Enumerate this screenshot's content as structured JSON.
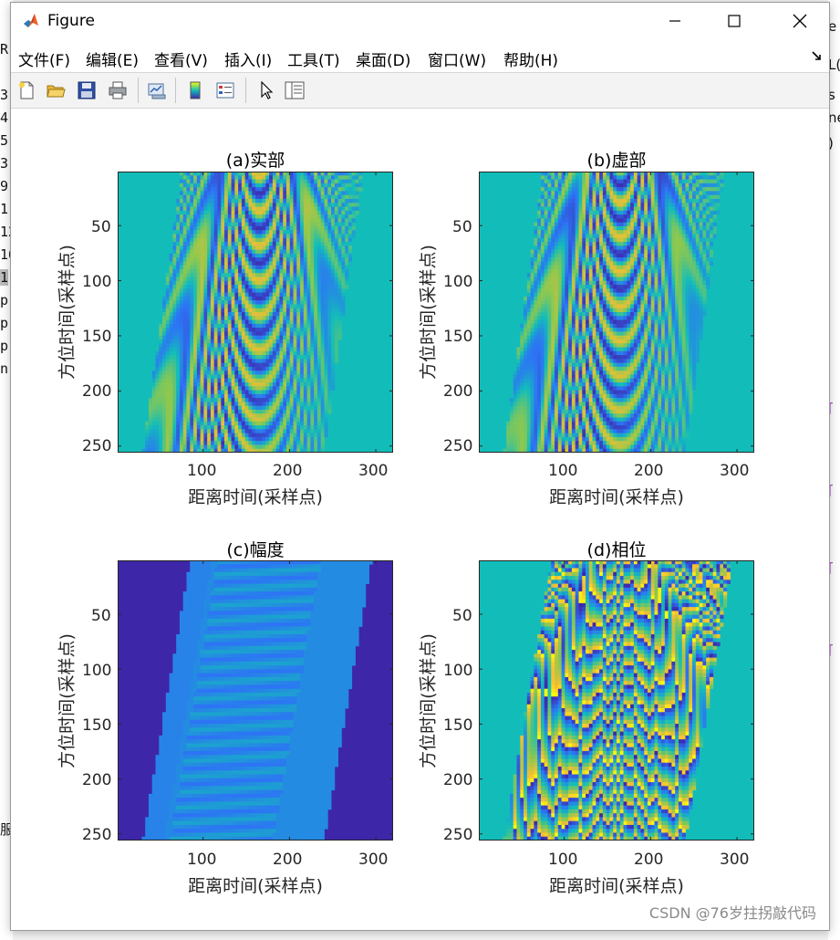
{
  "window": {
    "title": "Figure",
    "controls": {
      "minimize": "minimize",
      "maximize": "maximize",
      "close": "close"
    }
  },
  "menu": [
    "文件(F)",
    "编辑(E)",
    "查看(V)",
    "插入(I)",
    "工具(T)",
    "桌面(D)",
    "窗口(W)",
    "帮助(H)"
  ],
  "toolbar": [
    "new-figure-icon",
    "open-file-icon",
    "save-icon",
    "print-icon",
    "link-plot-icon",
    "colorbar-icon",
    "legend-icon",
    "pointer-icon",
    "property-inspector-icon"
  ],
  "background_text": {
    "left": [
      "R",
      "3.",
      "4.",
      "5.",
      "3.",
      "9.",
      "1(",
      "12",
      "16",
      "1",
      "p",
      "p",
      "p",
      "n",
      "服"
    ],
    "right": [
      "e",
      "L(",
      "s",
      "ne",
      ")"
    ]
  },
  "colors": {
    "parula_teal": "#12bdb9",
    "parula_dark": "#3e26a8",
    "parula_blue": "#2d74f5",
    "parula_yellow": "#f9fb0e"
  },
  "axes": [
    {
      "id": "a",
      "title": "(a)实部",
      "xlabel": "距离时间(采样点)",
      "ylabel": "方位时间(采样点)",
      "xticks": [
        "100",
        "200",
        "300"
      ],
      "yticks": [
        "50",
        "100",
        "150",
        "200",
        "250"
      ]
    },
    {
      "id": "b",
      "title": "(b)虚部",
      "xlabel": "距离时间(采样点)",
      "ylabel": "方位时间(采样点)",
      "xticks": [
        "100",
        "200",
        "300"
      ],
      "yticks": [
        "50",
        "100",
        "150",
        "200",
        "250"
      ]
    },
    {
      "id": "c",
      "title": "(c)幅度",
      "xlabel": "距离时间(采样点)",
      "ylabel": "方位时间(采样点)",
      "xticks": [
        "100",
        "200",
        "300"
      ],
      "yticks": [
        "50",
        "100",
        "150",
        "200",
        "250"
      ]
    },
    {
      "id": "d",
      "title": "(d)相位",
      "xlabel": "距离时间(采样点)",
      "ylabel": "方位时间(采样点)",
      "xticks": [
        "100",
        "200",
        "300"
      ],
      "yticks": [
        "50",
        "100",
        "150",
        "200",
        "250"
      ]
    }
  ],
  "chart_data": [
    {
      "type": "heatmap",
      "title": "(a)实部",
      "xlabel": "距离时间(采样点)",
      "ylabel": "方位时间(采样点)",
      "xlim": [
        1,
        320
      ],
      "ylim": [
        1,
        256
      ],
      "xticks": [
        100,
        200,
        300
      ],
      "yticks": [
        50,
        100,
        150,
        200,
        250
      ],
      "y_reversed": true,
      "colormap": "parula",
      "support_band": {
        "x_at_top": [
          75,
          285
        ],
        "x_at_bottom": [
          30,
          240
        ]
      }
    },
    {
      "type": "heatmap",
      "title": "(b)虚部",
      "xlabel": "距离时间(采样点)",
      "ylabel": "方位时间(采样点)",
      "xlim": [
        1,
        320
      ],
      "ylim": [
        1,
        256
      ],
      "xticks": [
        100,
        200,
        300
      ],
      "yticks": [
        50,
        100,
        150,
        200,
        250
      ],
      "y_reversed": true,
      "colormap": "parula",
      "support_band": {
        "x_at_top": [
          75,
          285
        ],
        "x_at_bottom": [
          30,
          240
        ]
      }
    },
    {
      "type": "heatmap",
      "title": "(c)幅度",
      "xlabel": "距离时间(采样点)",
      "ylabel": "方位时间(采样点)",
      "xlim": [
        1,
        320
      ],
      "ylim": [
        1,
        256
      ],
      "xticks": [
        100,
        200,
        300
      ],
      "yticks": [
        50,
        100,
        150,
        200,
        250
      ],
      "y_reversed": true,
      "colormap": "parula",
      "support_band": {
        "x_at_top": [
          85,
          295
        ],
        "x_at_bottom": [
          30,
          240
        ]
      }
    },
    {
      "type": "heatmap",
      "title": "(d)相位",
      "xlabel": "距离时间(采样点)",
      "ylabel": "方位时间(采样点)",
      "xlim": [
        1,
        320
      ],
      "ylim": [
        1,
        256
      ],
      "xticks": [
        100,
        200,
        300
      ],
      "yticks": [
        50,
        100,
        150,
        200,
        250
      ],
      "y_reversed": true,
      "colormap": "parula",
      "support_band": {
        "x_at_top": [
          85,
          295
        ],
        "x_at_bottom": [
          30,
          240
        ]
      }
    }
  ],
  "watermark": "CSDN @76岁拄拐敲代码"
}
